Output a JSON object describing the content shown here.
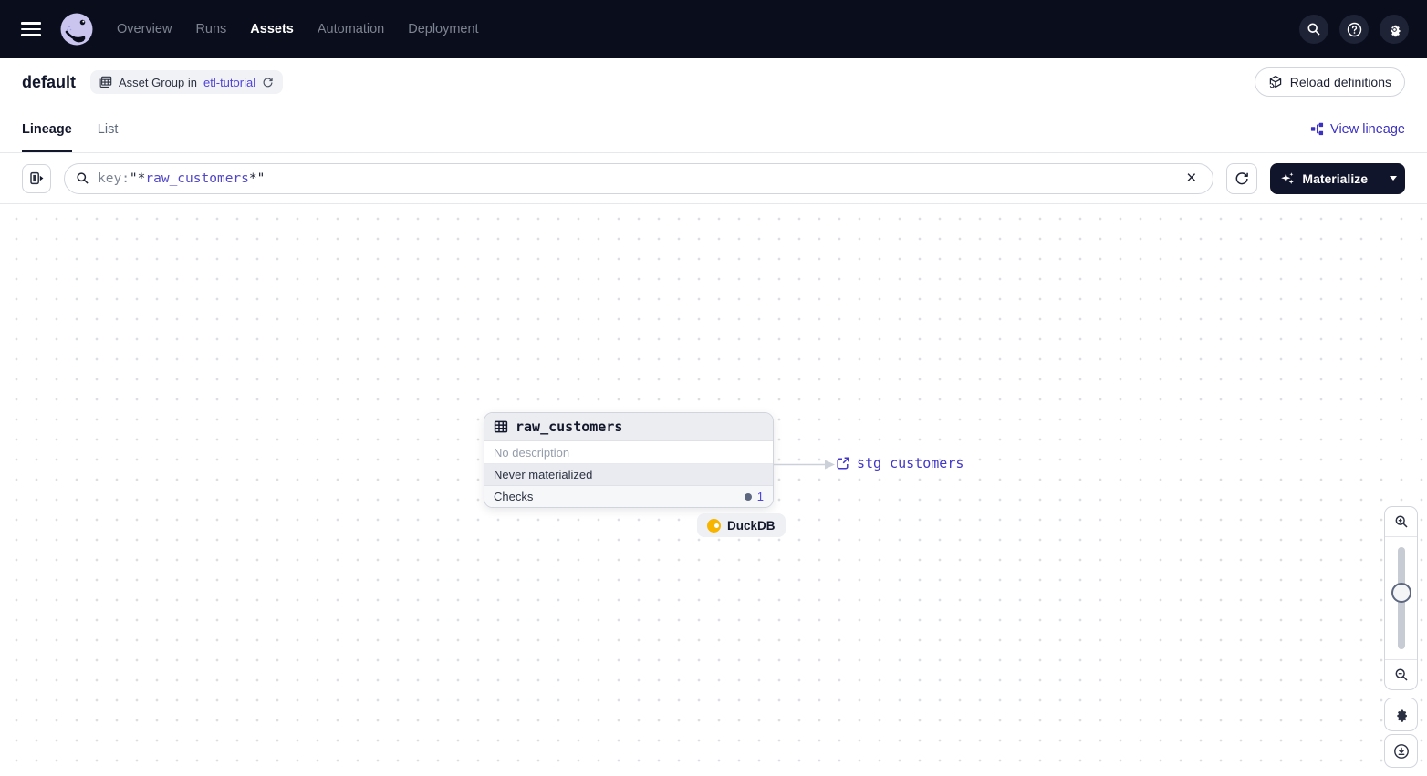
{
  "topnav": {
    "items": [
      {
        "label": "Overview",
        "active": false
      },
      {
        "label": "Runs",
        "active": false
      },
      {
        "label": "Assets",
        "active": true
      },
      {
        "label": "Automation",
        "active": false
      },
      {
        "label": "Deployment",
        "active": false
      }
    ]
  },
  "header": {
    "title": "default",
    "badge_text": "Asset Group in",
    "badge_link": "etl-tutorial",
    "reload_label": "Reload definitions"
  },
  "tabs": {
    "lineage": "Lineage",
    "list": "List",
    "view_lineage": "View lineage"
  },
  "toolbar": {
    "filter_prefix": "key:",
    "filter_open": "\"*",
    "filter_value": "raw_customers",
    "filter_close": "*\"",
    "materialize_label": "Materialize"
  },
  "graph": {
    "node": {
      "title": "raw_customers",
      "description": "No description",
      "status": "Never materialized",
      "checks_label": "Checks",
      "checks_count": "1",
      "kind_badge": "DuckDB"
    },
    "downstream_label": "stg_customers"
  },
  "colors": {
    "nav_bg": "#0a0d1c",
    "accent_indigo": "#4f43dd",
    "link_indigo": "#3b31c4",
    "duckdb_yellow": "#f7b500",
    "status_row_bg": "#e9ebf0"
  }
}
